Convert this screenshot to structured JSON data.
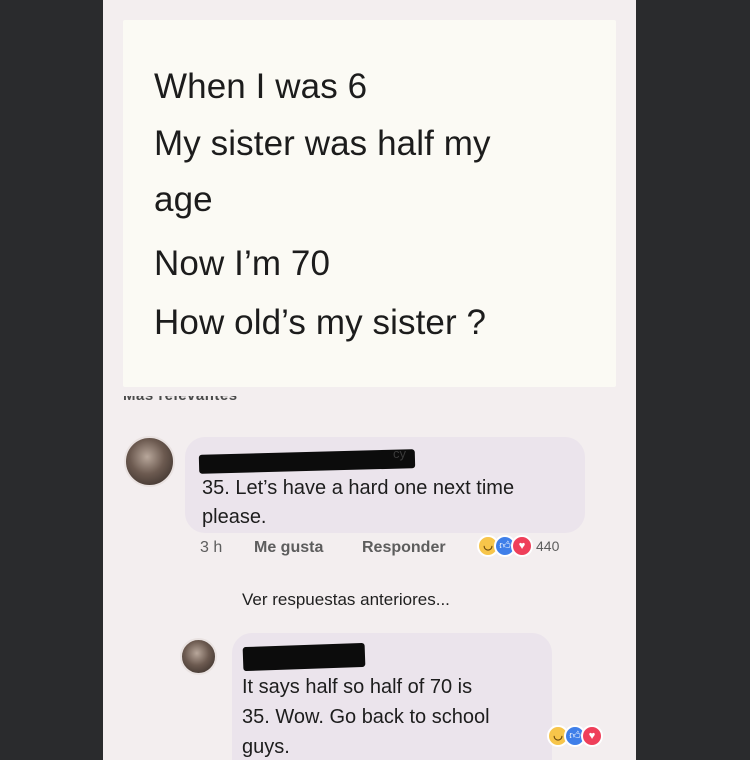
{
  "post": {
    "lines": [
      "When I was 6",
      "My sister was half my",
      "age",
      "Now I’m 70",
      "How old’s my sister ?"
    ]
  },
  "section_heading": "Más relevantes",
  "comments": [
    {
      "name_visible_fragment": "cy",
      "text_lines": [
        "35. Let’s have a hard one next time",
        "please."
      ],
      "time": "3 h",
      "like_label": "Me gusta",
      "reply_label": "Responder",
      "reactions": [
        "haha-icon",
        "like-icon",
        "love-icon"
      ],
      "reaction_count": "440"
    }
  ],
  "more_replies_label": "Ver respuestas anteriores...",
  "reply": {
    "text_lines": [
      "It says half so half of 70 is",
      "35. Wow. Go back to school",
      "guys."
    ],
    "reactions": [
      "haha-icon",
      "like-icon",
      "love-icon"
    ]
  },
  "colors": {
    "haha": "#f7c54a",
    "like": "#3f7fe9",
    "love": "#ef3f5a",
    "bubble": "#ebe4ec"
  }
}
